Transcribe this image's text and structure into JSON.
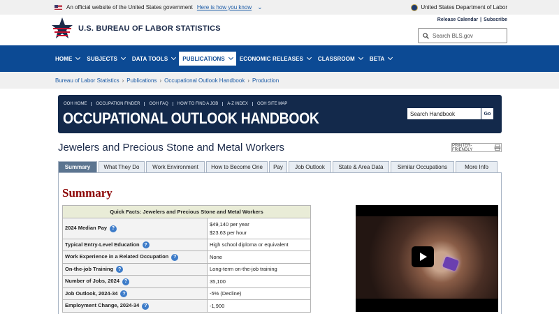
{
  "gov_banner": {
    "text": "An official website of the United States government",
    "link": "Here is how you know",
    "dept": "United States Department of Labor"
  },
  "masthead": {
    "title": "U.S. BUREAU OF LABOR STATISTICS",
    "release_calendar": "Release Calendar",
    "subscribe": "Subscribe",
    "search_placeholder": "Search BLS.gov"
  },
  "nav": [
    {
      "label": "HOME"
    },
    {
      "label": "SUBJECTS"
    },
    {
      "label": "DATA TOOLS"
    },
    {
      "label": "PUBLICATIONS"
    },
    {
      "label": "ECONOMIC RELEASES"
    },
    {
      "label": "CLASSROOM"
    },
    {
      "label": "BETA"
    }
  ],
  "breadcrumb": [
    "Bureau of Labor Statistics",
    "Publications",
    "Occupational Outlook Handbook",
    "Production"
  ],
  "ooh": {
    "links": [
      "OOH HOME",
      "OCCUPATION FINDER",
      "OOH FAQ",
      "HOW TO FIND A JOB",
      "A-Z INDEX",
      "OOH SITE MAP"
    ],
    "title": "OCCUPATIONAL OUTLOOK HANDBOOK",
    "search_value": "Search Handbook",
    "go": "Go"
  },
  "occupation_title": "Jewelers and Precious Stone and Metal Workers",
  "printer_label": "PRINTER-FRIENDLY",
  "tabs": [
    {
      "label": "Summary"
    },
    {
      "label": "What They Do"
    },
    {
      "label": "Work Environment"
    },
    {
      "label": "How to Become One"
    },
    {
      "label": "Pay"
    },
    {
      "label": "Job Outlook"
    },
    {
      "label": "State & Area Data"
    },
    {
      "label": "Similar Occupations"
    },
    {
      "label": "More Info"
    }
  ],
  "summary_heading": "Summary",
  "quick_facts": {
    "header": "Quick Facts: Jewelers and Precious Stone and Metal Workers",
    "rows": [
      {
        "label": "2024 Median Pay",
        "value": "$49,140 per year",
        "value2": "$23.63 per hour"
      },
      {
        "label": "Typical Entry-Level Education",
        "value": "High school diploma or equivalent"
      },
      {
        "label": "Work Experience in a Related Occupation",
        "value": "None"
      },
      {
        "label": "On-the-job Training",
        "value": "Long-term on-the-job training"
      },
      {
        "label": "Number of Jobs, 2024",
        "value": "35,100"
      },
      {
        "label": "Job Outlook, 2024-34",
        "value": "-5% (Decline)"
      },
      {
        "label": "Employment Change, 2024-34",
        "value": "-1,900"
      }
    ]
  },
  "colors": {
    "nav_blue": "#0c4a94",
    "ooh_navy": "#13294b",
    "summary_red": "#8b0000",
    "active_tab": "#5c7590"
  }
}
